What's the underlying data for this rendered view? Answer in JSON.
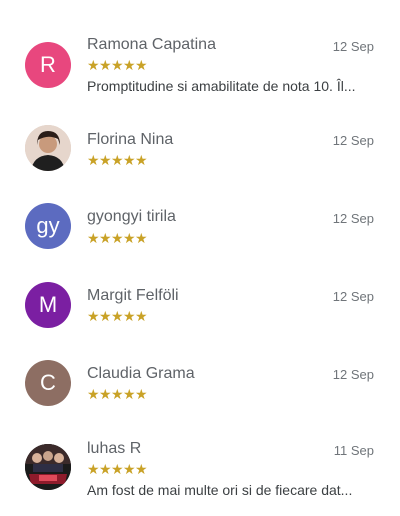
{
  "reviews": [
    {
      "name": "Ramona Capatina",
      "date": "12 Sep",
      "rating": 5,
      "avatar_letter": "R",
      "avatar_color": "#e8477e",
      "text": "Promptitudine si amabilitate de nota 10. Îl..."
    },
    {
      "name": "Florina Nina",
      "date": "12 Sep",
      "rating": 5,
      "avatar_icon": "profile-photo",
      "text": ""
    },
    {
      "name": "gyongyi tirila",
      "date": "12 Sep",
      "rating": 5,
      "avatar_letter": "gy",
      "avatar_color": "#5c6bc0",
      "text": ""
    },
    {
      "name": "Margit Felföli",
      "date": "12 Sep",
      "rating": 5,
      "avatar_letter": "M",
      "avatar_color": "#7b1fa2",
      "text": ""
    },
    {
      "name": "Claudia Grama",
      "date": "12 Sep",
      "rating": 5,
      "avatar_letter": "C",
      "avatar_color": "#8d6e63",
      "text": ""
    },
    {
      "name": "luhas R",
      "date": "11 Sep",
      "rating": 5,
      "avatar_icon": "profile-photo",
      "text": "Am fost de mai multe ori si de fiecare dat..."
    }
  ],
  "star_glyph": "★",
  "star_color": "#c9a227"
}
